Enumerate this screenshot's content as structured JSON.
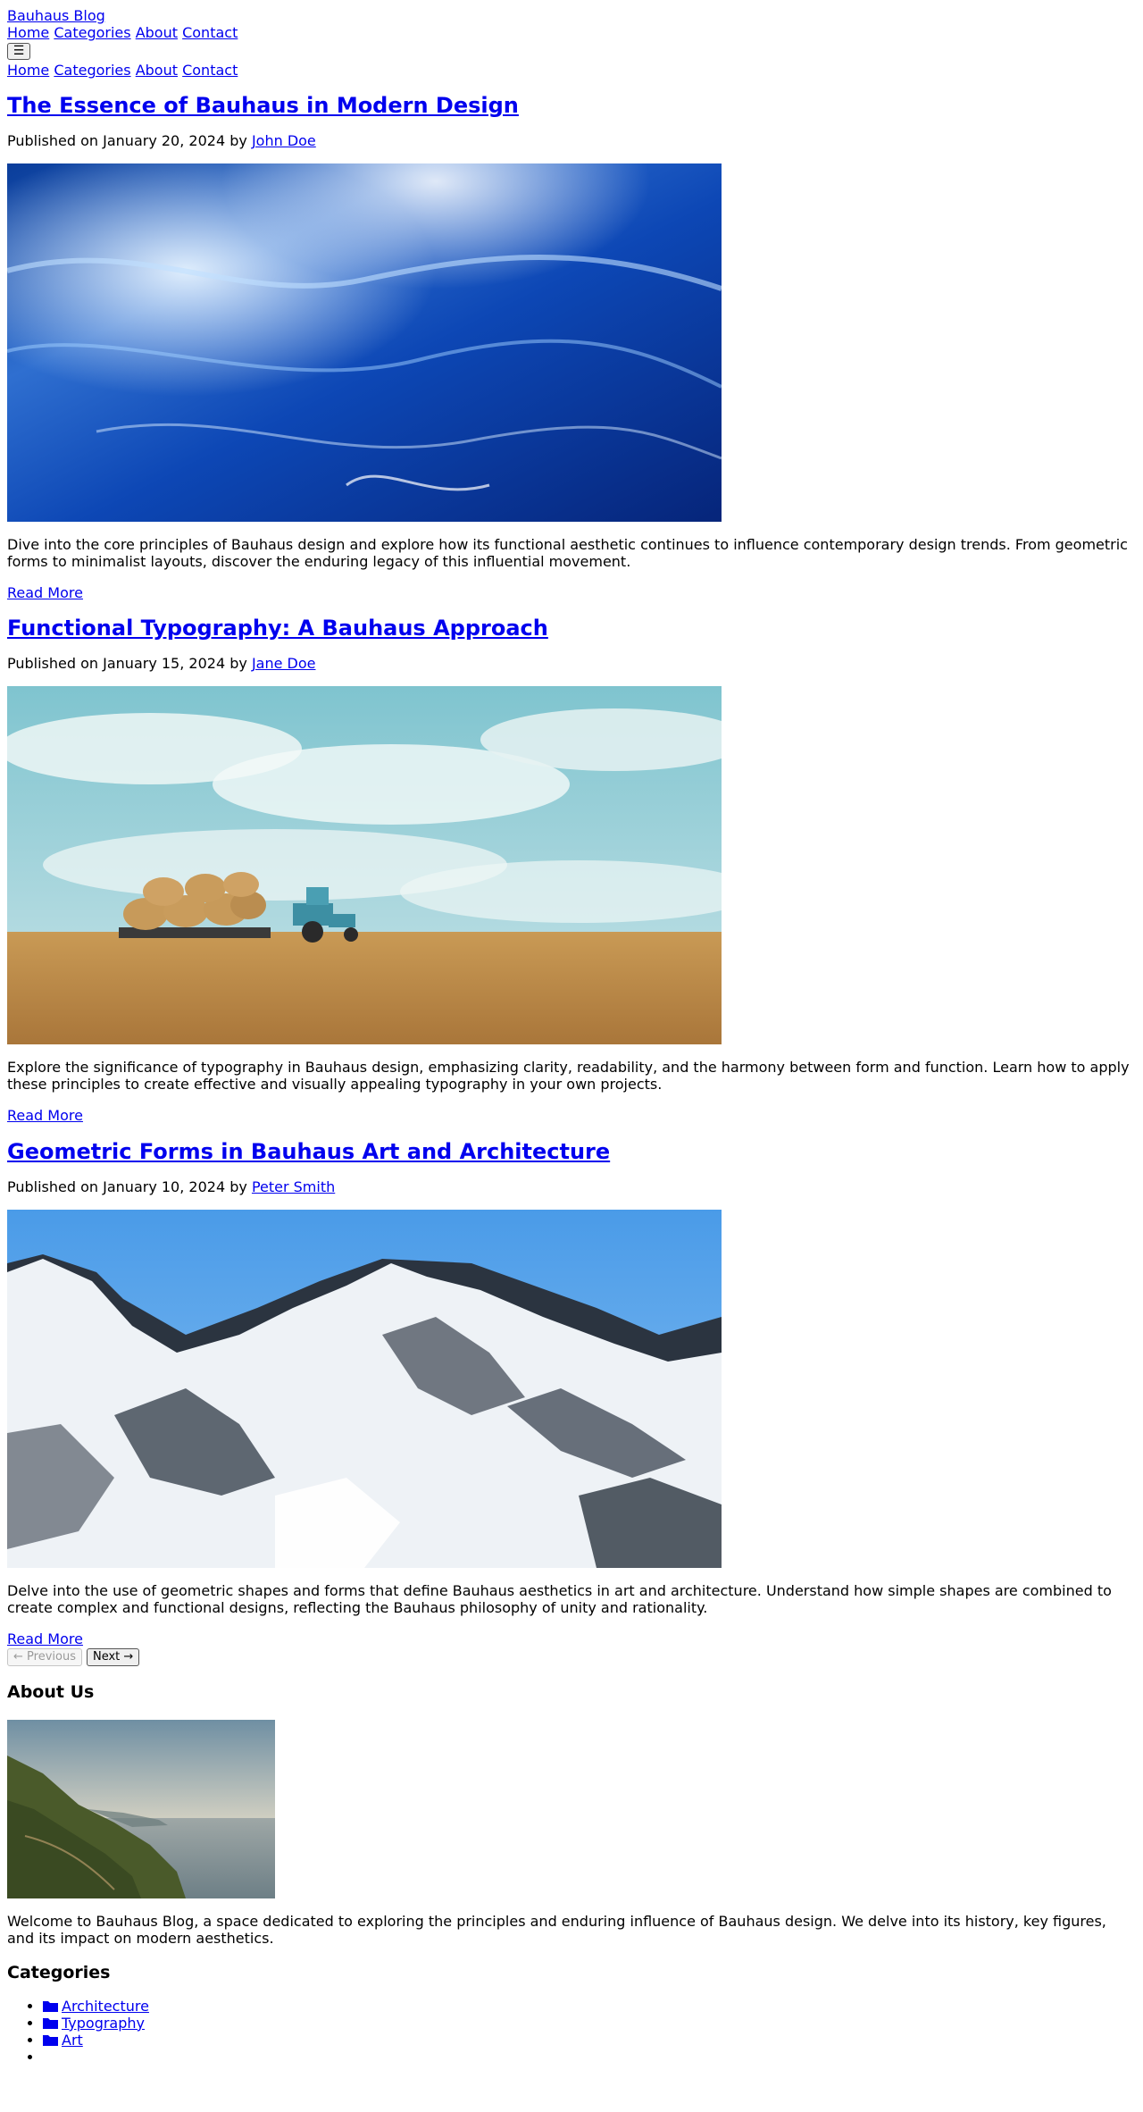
{
  "site": {
    "brand": "Bauhaus Blog"
  },
  "nav": {
    "items": [
      "Home",
      "Categories",
      "About",
      "Contact"
    ],
    "menu_toggle_glyph": "☰"
  },
  "posts": [
    {
      "title": "The Essence of Bauhaus in Modern Design",
      "meta_prefix": "Published on January 20, 2024 by",
      "author": "John Doe",
      "image": "ocean-waves",
      "excerpt": "Dive into the core principles of Bauhaus design and explore how its functional aesthetic continues to influence contemporary design trends. From geometric forms to minimalist layouts, discover the enduring legacy of this influential movement.",
      "read_more": "Read More"
    },
    {
      "title": "Functional Typography: A Bauhaus Approach",
      "meta_prefix": "Published on January 15, 2024 by",
      "author": "Jane Doe",
      "image": "tractor-hay-field",
      "excerpt": "Explore the significance of typography in Bauhaus design, emphasizing clarity, readability, and the harmony between form and function. Learn how to apply these principles to create effective and visually appealing typography in your own projects.",
      "read_more": "Read More"
    },
    {
      "title": "Geometric Forms in Bauhaus Art and Architecture",
      "meta_prefix": "Published on January 10, 2024 by",
      "author": "Peter Smith",
      "image": "snowy-mountains",
      "excerpt": "Delve into the use of geometric shapes and forms that define Bauhaus aesthetics in art and architecture. Understand how simple shapes are combined to create complex and functional designs, reflecting the Bauhaus philosophy of unity and rationality.",
      "read_more": "Read More"
    }
  ],
  "pagination": {
    "previous": "← Previous",
    "next": "Next →"
  },
  "about": {
    "heading": "About Us",
    "image": "coastal-cliffs",
    "text": "Welcome to Bauhaus Blog, a space dedicated to exploring the principles and enduring influence of Bauhaus design. We delve into its history, key figures, and its impact on modern aesthetics."
  },
  "categories": {
    "heading": "Categories",
    "items": [
      "Architecture",
      "Typography",
      "Art",
      ""
    ],
    "icon": "folder-icon"
  },
  "colors": {
    "link": "#0000ee",
    "text": "#000000",
    "background": "#ffffff"
  }
}
